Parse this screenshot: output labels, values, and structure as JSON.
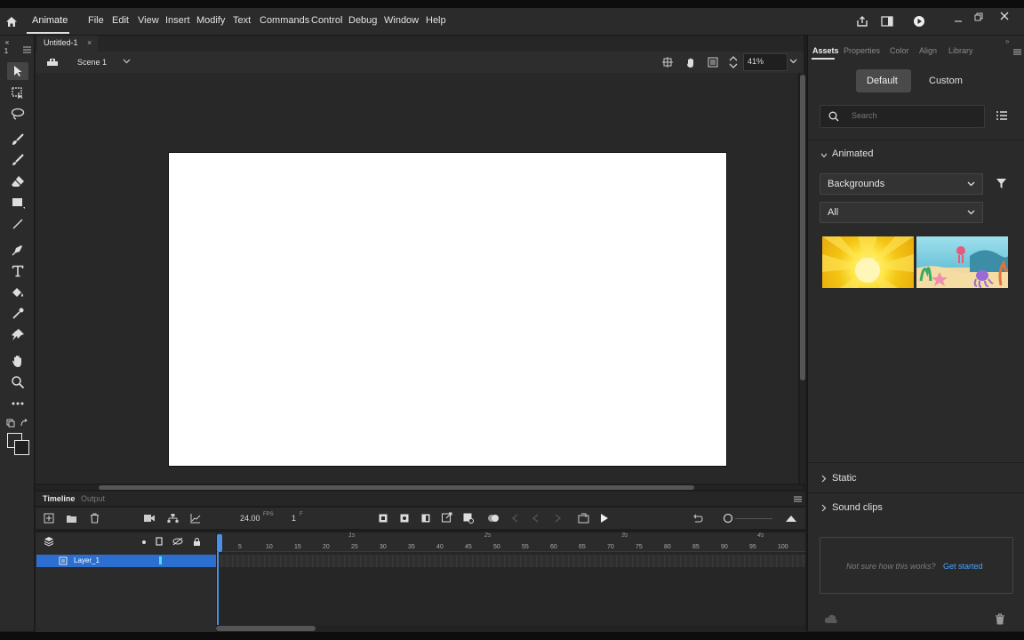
{
  "app": {
    "name": "Animate"
  },
  "menu": [
    "File",
    "Edit",
    "View",
    "Insert",
    "Modify",
    "Text",
    "Commands",
    "Control",
    "Debug",
    "Window",
    "Help"
  ],
  "document": {
    "tab_title": "Untitled-1",
    "scene": "Scene 1",
    "zoom": "41%"
  },
  "timeline": {
    "tabs": [
      "Timeline",
      "Output"
    ],
    "fps": "24.00",
    "fps_unit": "FPS",
    "current_frame": "1",
    "frame_unit": "F",
    "seconds": [
      "1s",
      "2s",
      "3s",
      "4s"
    ],
    "frame_ticks": [
      "5",
      "10",
      "15",
      "20",
      "25",
      "30",
      "35",
      "40",
      "45",
      "50",
      "55",
      "60",
      "65",
      "70",
      "75",
      "80",
      "85",
      "90",
      "95",
      "100"
    ],
    "layers": [
      {
        "name": "Layer_1"
      }
    ]
  },
  "panel": {
    "tabs": [
      "Assets",
      "Properties",
      "Color",
      "Align",
      "Library"
    ],
    "toggle": [
      "Default",
      "Custom"
    ],
    "search_placeholder": "Search",
    "section_animated": "Animated",
    "category_select": "Backgrounds",
    "filter_select": "All",
    "section_static": "Static",
    "section_sound": "Sound clips",
    "help_text": "Not sure how this works?",
    "help_link": "Get started"
  },
  "colors": {
    "accent": "#2d6fd1",
    "link": "#4aa3ff",
    "playhead": "#4b8fe6",
    "stage": "#ffffff"
  }
}
